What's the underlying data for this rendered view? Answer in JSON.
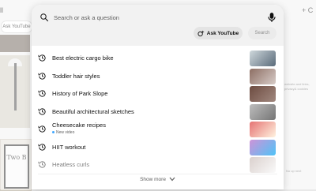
{
  "background": {
    "corner_glyph": "ll",
    "ask_chip_label": "Ask YouTube",
    "plus_label": "+ C",
    "art_text": "Two B",
    "side_text": "website and links, privacy& cookies",
    "side_text2": "No up next"
  },
  "search": {
    "placeholder": "Search or ask a question",
    "ask_label": "Ask YouTube",
    "search_label": "Search"
  },
  "suggestions": [
    {
      "label": "Best electric cargo bike",
      "sub": "",
      "thumb": [
        "#cfd8dc",
        "#5a6b7a"
      ]
    },
    {
      "label": "Toddler hair styles",
      "sub": "",
      "thumb": [
        "#8d6e63",
        "#d7ccc8"
      ]
    },
    {
      "label": "History of Park Slope",
      "sub": "",
      "thumb": [
        "#6d4c41",
        "#a1887f"
      ]
    },
    {
      "label": "Beautiful architectural sketches",
      "sub": "",
      "thumb": [
        "#bdbdbd",
        "#757575"
      ]
    },
    {
      "label": "Cheesecake recipes",
      "sub": "New video",
      "thumb": [
        "#e57373",
        "#fff3e0"
      ]
    },
    {
      "label": "HIIT workout",
      "sub": "",
      "thumb": [
        "#ce93d8",
        "#4fc3f7"
      ]
    },
    {
      "label": "Heatless curls",
      "sub": "",
      "thumb": [
        "#bcaaa4",
        "#f5f5f5"
      ]
    }
  ],
  "show_more_label": "Show more"
}
